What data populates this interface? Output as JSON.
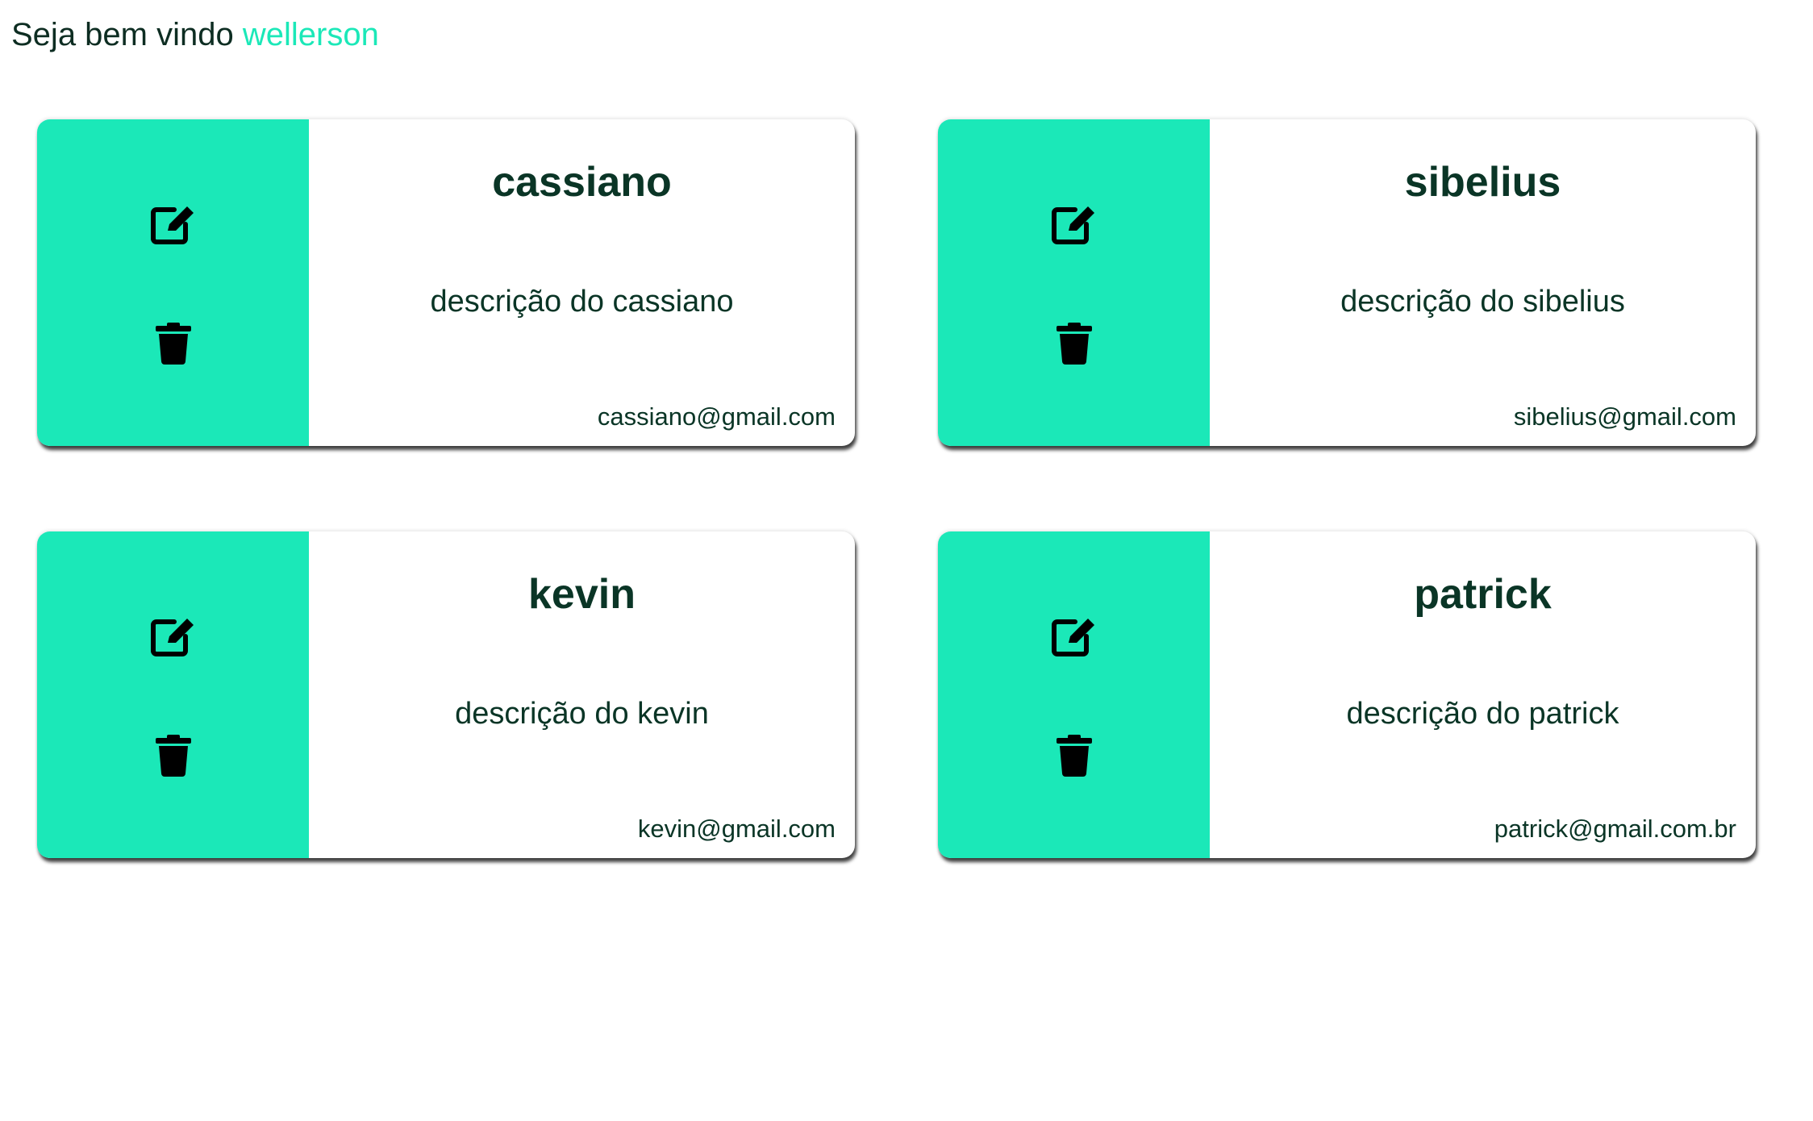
{
  "header": {
    "greeting": "Seja bem vindo",
    "username": "wellerson"
  },
  "theme": {
    "accent": "#1be8b8",
    "text": "#0a3526"
  },
  "cards": [
    {
      "name": "cassiano",
      "description": "descrição do cassiano",
      "email": "cassiano@gmail.com",
      "edit_icon": "edit-icon",
      "delete_icon": "trash-icon"
    },
    {
      "name": "sibelius",
      "description": "descrição do sibelius",
      "email": "sibelius@gmail.com",
      "edit_icon": "edit-icon",
      "delete_icon": "trash-icon"
    },
    {
      "name": "kevin",
      "description": "descrição do kevin",
      "email": "kevin@gmail.com",
      "edit_icon": "edit-icon",
      "delete_icon": "trash-icon"
    },
    {
      "name": "patrick",
      "description": "descrição do patrick",
      "email": "patrick@gmail.com.br",
      "edit_icon": "edit-icon",
      "delete_icon": "trash-icon"
    }
  ]
}
